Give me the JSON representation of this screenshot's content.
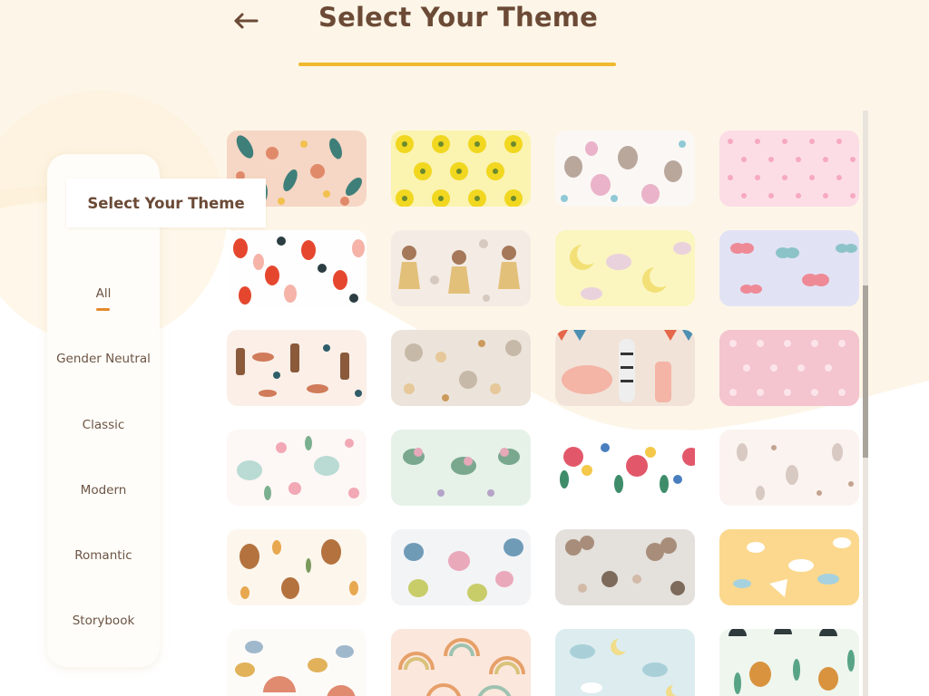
{
  "header": {
    "title": "Select Your Theme",
    "back_icon": "arrow-left-icon"
  },
  "sidebar": {
    "heading": "Select Your Theme",
    "filters": [
      {
        "label": "All",
        "active": true
      },
      {
        "label": "Gender Neutral",
        "active": false
      },
      {
        "label": "Classic",
        "active": false
      },
      {
        "label": "Modern",
        "active": false
      },
      {
        "label": "Romantic",
        "active": false
      },
      {
        "label": "Storybook",
        "active": false
      }
    ]
  },
  "themes": [
    {
      "name": "botanical-leaves-icon"
    },
    {
      "name": "sunflower-pattern-icon"
    },
    {
      "name": "unicorn-pattern-icon"
    },
    {
      "name": "pink-star-pattern-icon"
    },
    {
      "name": "strawberry-pattern-icon"
    },
    {
      "name": "fairy-girls-pattern-icon"
    },
    {
      "name": "yellow-moon-pattern-icon"
    },
    {
      "name": "butterfly-pattern-icon"
    },
    {
      "name": "cowboy-pattern-icon"
    },
    {
      "name": "sun-moon-pattern-icon"
    },
    {
      "name": "safari-animals-icon"
    },
    {
      "name": "pink-hearts-pattern-icon"
    },
    {
      "name": "teapot-floral-icon"
    },
    {
      "name": "green-floral-icon"
    },
    {
      "name": "rose-bouquet-icon"
    },
    {
      "name": "bunny-pattern-icon"
    },
    {
      "name": "bear-pattern-icon"
    },
    {
      "name": "elephant-pattern-icon"
    },
    {
      "name": "balloon-bear-icon"
    },
    {
      "name": "stork-clouds-icon"
    },
    {
      "name": "turtle-rainbow-icon"
    },
    {
      "name": "rainbow-pattern-icon"
    },
    {
      "name": "moon-clouds-icon"
    },
    {
      "name": "jungle-animals-icon"
    }
  ],
  "colors": {
    "title": "#6b4a36",
    "accent_underline": "#f0b92e",
    "active_filter_bar": "#e38a2d",
    "page_background": "#fdf6e8"
  }
}
